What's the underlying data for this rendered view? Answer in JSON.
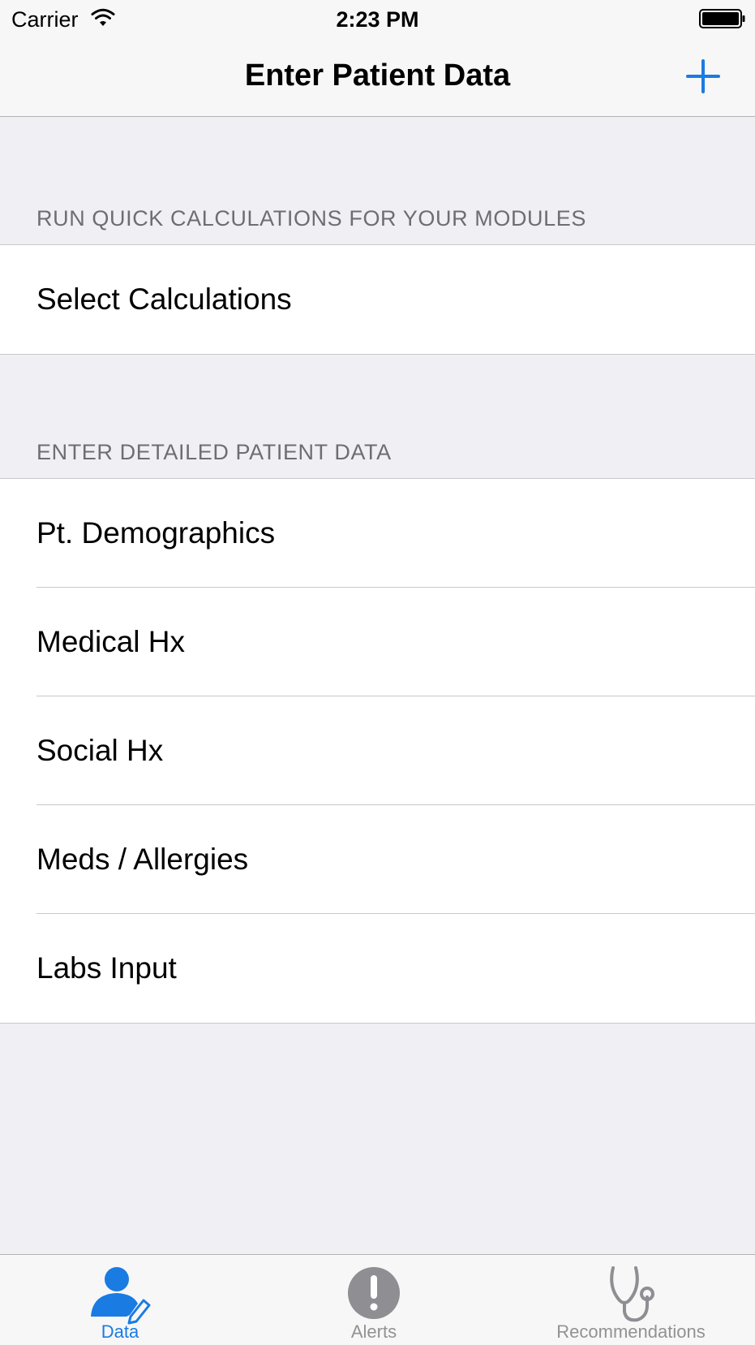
{
  "status_bar": {
    "carrier": "Carrier",
    "time": "2:23 PM"
  },
  "nav": {
    "title": "Enter Patient Data",
    "add_icon": "plus-icon"
  },
  "sections": [
    {
      "header": "RUN QUICK CALCULATIONS FOR YOUR MODULES",
      "items": [
        "Select Calculations"
      ]
    },
    {
      "header": "ENTER DETAILED PATIENT DATA",
      "items": [
        "Pt. Demographics",
        "Medical Hx",
        "Social Hx",
        "Meds / Allergies",
        "Labs Input"
      ]
    }
  ],
  "tab_bar": {
    "tabs": [
      {
        "label": "Data",
        "icon": "person-edit-icon",
        "active": true
      },
      {
        "label": "Alerts",
        "icon": "exclamation-circle-icon",
        "active": false
      },
      {
        "label": "Recommendations",
        "icon": "stethoscope-icon",
        "active": false
      }
    ]
  },
  "colors": {
    "accent": "#1a7be3",
    "background": "#efeff4",
    "inactive_tab": "#929292",
    "section_header": "#6d6d72"
  }
}
